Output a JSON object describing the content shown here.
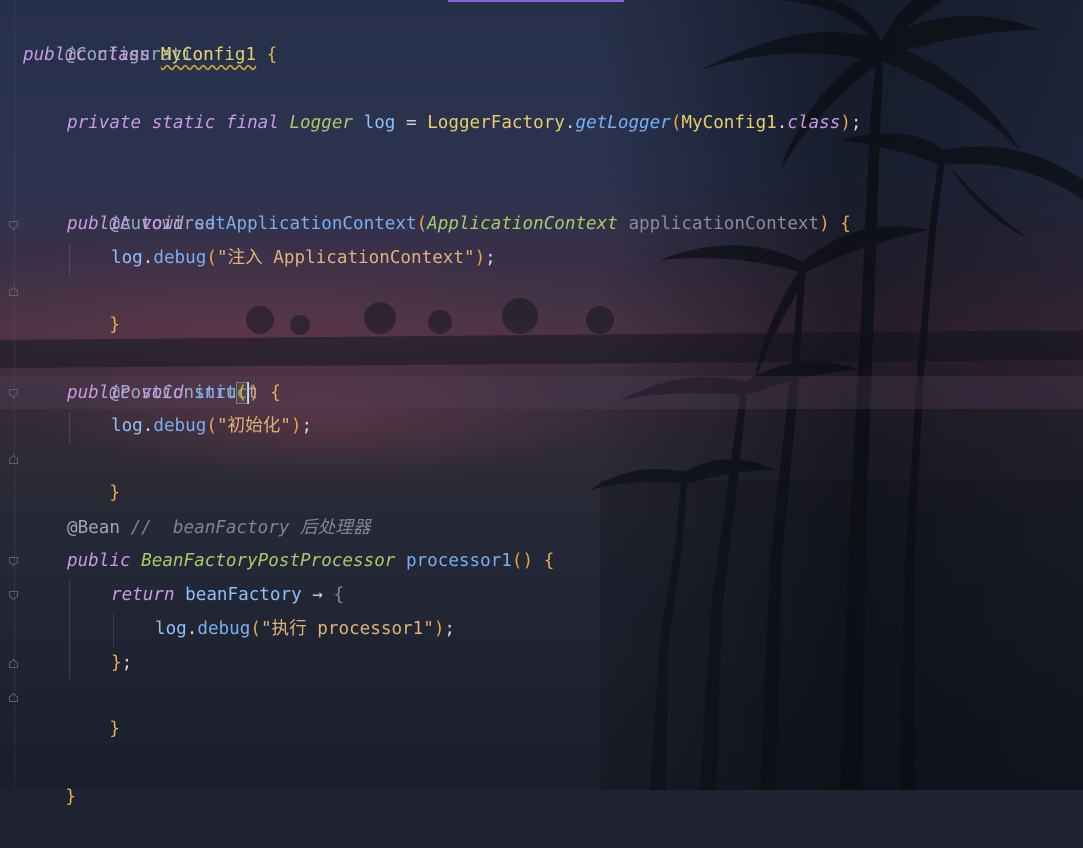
{
  "editor": {
    "accent_color": "#8a64d6",
    "lines": [
      {
        "id": "l1",
        "parts": [
          "@Configuration"
        ]
      },
      {
        "id": "l2",
        "parts": [
          "public",
          " ",
          "class",
          " ",
          "MyConfig1",
          " ",
          "{"
        ]
      },
      {
        "id": "l4",
        "parts": [
          "private",
          " ",
          "static",
          " ",
          "final",
          " ",
          "Logger",
          " ",
          "log",
          " = ",
          "LoggerFactory",
          ".",
          "getLogger",
          "(",
          "MyConfig1",
          ".",
          "class",
          ")",
          ";"
        ]
      },
      {
        "id": "l6",
        "parts": [
          "@Autowired"
        ]
      },
      {
        "id": "l7",
        "parts": [
          "public",
          " ",
          "void",
          " ",
          "setApplicationContext",
          "(",
          "ApplicationContext",
          " ",
          "applicationContext",
          ")",
          " ",
          "{"
        ]
      },
      {
        "id": "l8",
        "parts": [
          "log",
          ".",
          "debug",
          "(",
          "\"注入 ApplicationContext\"",
          ")",
          ";"
        ]
      },
      {
        "id": "l9",
        "parts": [
          "}"
        ]
      },
      {
        "id": "l11",
        "parts": [
          "@PostConstruct"
        ]
      },
      {
        "id": "l12",
        "parts": [
          "public",
          " ",
          "void",
          " ",
          "init",
          "(",
          ")",
          " ",
          "{"
        ]
      },
      {
        "id": "l13",
        "parts": [
          "log",
          ".",
          "debug",
          "(",
          "\"初始化\"",
          ")",
          ";"
        ]
      },
      {
        "id": "l14",
        "parts": [
          "}"
        ]
      },
      {
        "id": "l16",
        "parts": [
          "@Bean",
          " ",
          "//  beanFactory 后处理器"
        ]
      },
      {
        "id": "l17",
        "parts": [
          "public",
          " ",
          "BeanFactoryPostProcessor",
          " ",
          "processor1",
          "(",
          ")",
          " ",
          "{"
        ]
      },
      {
        "id": "l18",
        "parts": [
          "return",
          " ",
          "beanFactory",
          " ",
          "→",
          " ",
          "{"
        ]
      },
      {
        "id": "l19",
        "parts": [
          "log",
          ".",
          "debug",
          "(",
          "\"执行 processor1\"",
          ")",
          ";"
        ]
      },
      {
        "id": "l20",
        "parts": [
          "}",
          ";"
        ]
      },
      {
        "id": "l21",
        "parts": [
          "}"
        ]
      },
      {
        "id": "l23",
        "parts": [
          "}"
        ]
      }
    ]
  }
}
